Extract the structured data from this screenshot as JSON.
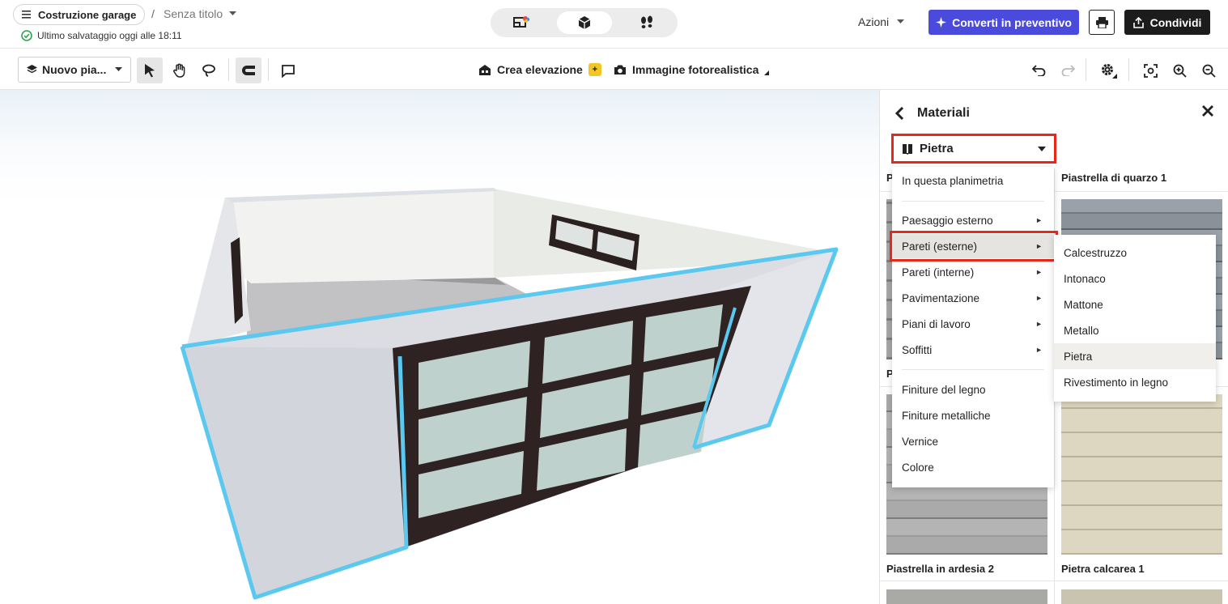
{
  "header": {
    "project_name": "Costruzione garage",
    "separator": "/",
    "untitled": "Senza titolo",
    "saved_status": "Ultimo salvataggio oggi alle 18:11",
    "view_modes": [
      "2d-3d-icon",
      "3d-box-icon",
      "walkthrough-icon"
    ],
    "actions_label": "Azioni",
    "convert_label": "Converti in preventivo",
    "share_label": "Condividi"
  },
  "toolbar": {
    "floor_label": "Nuovo pia...",
    "elevation_label": "Crea elevazione",
    "ai_badge": "+",
    "photo_label": "Immagine fotorealistica"
  },
  "panel": {
    "title": "Materiali",
    "category_selected": "Pietra",
    "tiles": [
      {
        "label": "P",
        "color": "#9c9c9c"
      },
      {
        "label": "Piastrella di quarzo 1",
        "color": "#7d848b"
      },
      {
        "label": "P",
        "color": "#8e8e8e"
      },
      {
        "label": "Piastrella in ardesia 2",
        "color": "#a5a6a5"
      },
      {
        "label": "Pietra calcarea 1",
        "color": "#d9d3bd"
      }
    ]
  },
  "menu": {
    "items": [
      {
        "label": "In questa planimetria",
        "arrow": false
      },
      {
        "label": "Paesaggio esterno",
        "arrow": true
      },
      {
        "label": "Pareti (esterne)",
        "arrow": true,
        "highlighted": true
      },
      {
        "label": "Pareti (interne)",
        "arrow": true
      },
      {
        "label": "Pavimentazione",
        "arrow": true
      },
      {
        "label": "Piani di lavoro",
        "arrow": true
      },
      {
        "label": "Soffitti",
        "arrow": true
      },
      {
        "label": "Finiture del legno",
        "arrow": false
      },
      {
        "label": "Finiture metalliche",
        "arrow": false
      },
      {
        "label": "Vernice",
        "arrow": false
      },
      {
        "label": "Colore",
        "arrow": false
      }
    ],
    "arrow_glyph": "►"
  },
  "submenu": {
    "items": [
      "Calcestruzzo",
      "Intonaco",
      "Mattone",
      "Metallo",
      "Pietra",
      "Rivestimento in legno"
    ],
    "selected": "Pietra"
  },
  "colors": {
    "accent": "#4a4bdc",
    "highlight_red": "#e8271b",
    "selection_outline": "#5bc8ef",
    "saved_green": "#2ea44f"
  }
}
